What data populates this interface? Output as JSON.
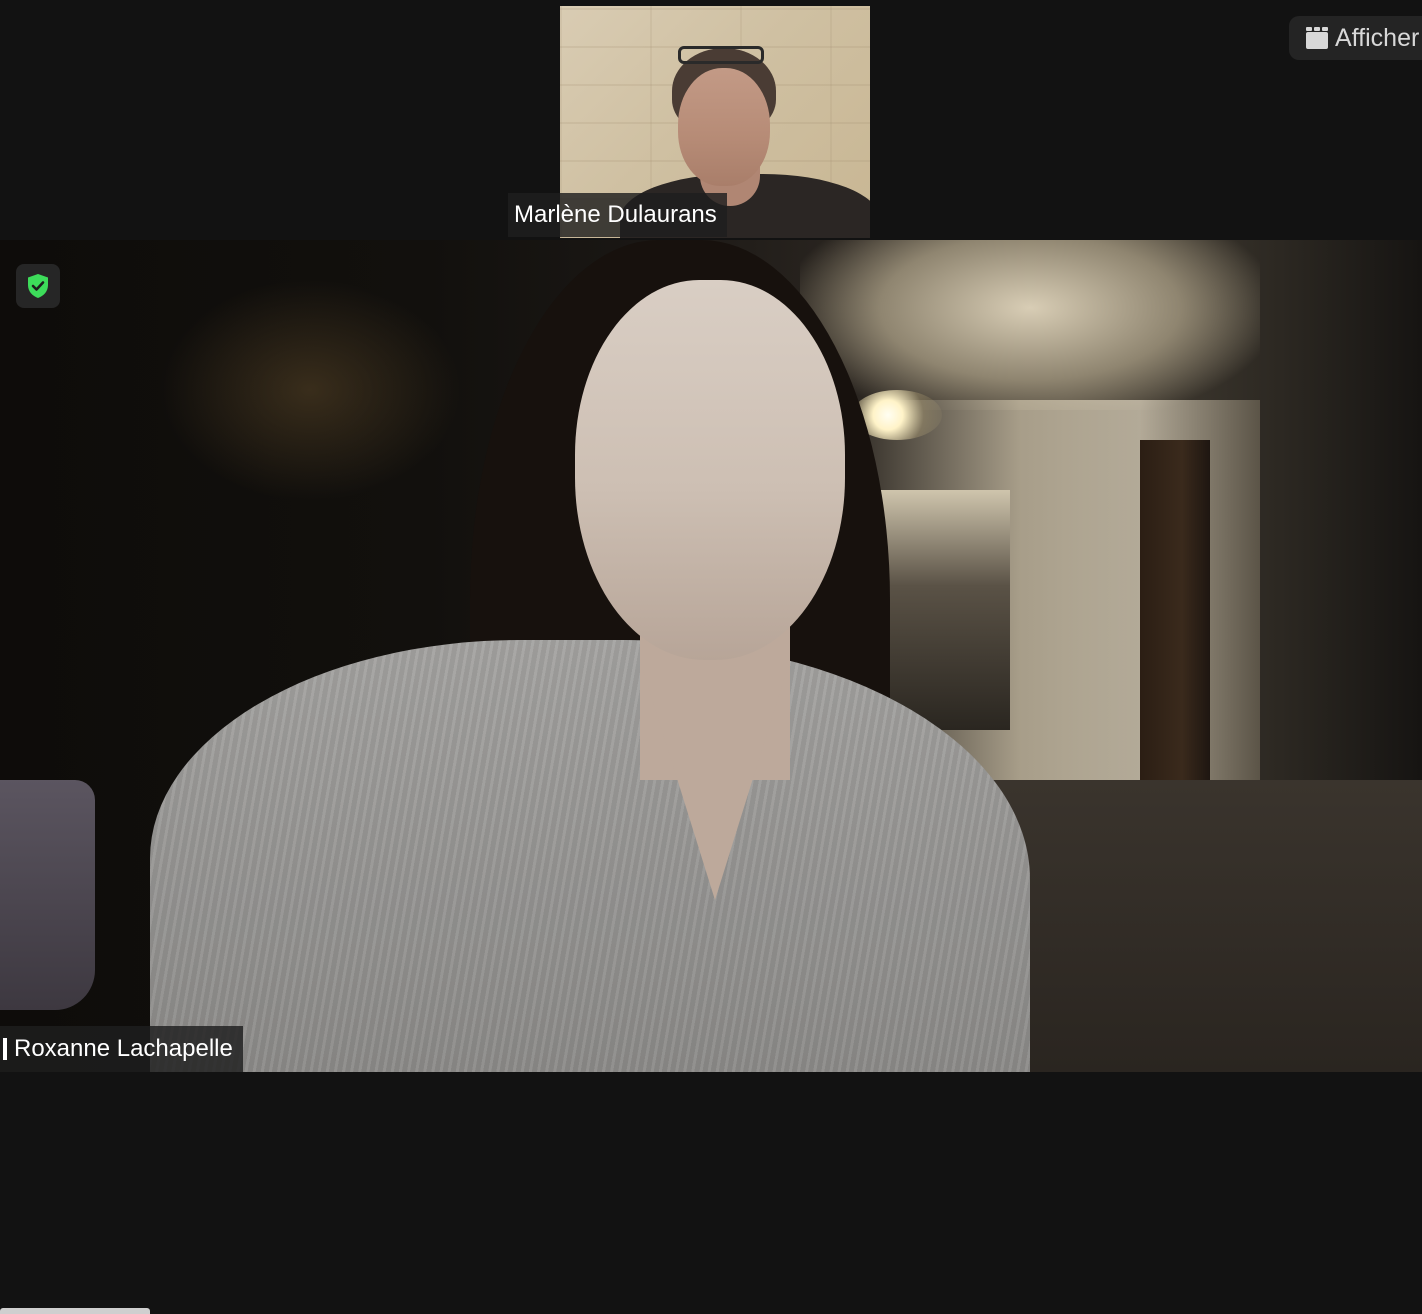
{
  "participants": {
    "thumbnail": {
      "name": "Marlène Dulaurans"
    },
    "main": {
      "name": "Roxanne Lachapelle"
    }
  },
  "toolbar": {
    "view_button_label": "Afficher",
    "view_button_icon": "grid-view-icon"
  },
  "security": {
    "icon": "shield-check-icon",
    "color": "#3ddc5a"
  },
  "colors": {
    "background": "#121212",
    "name_tag_bg": "#1e1e1e",
    "name_tag_text": "#ffffff",
    "button_bg": "#242424"
  }
}
